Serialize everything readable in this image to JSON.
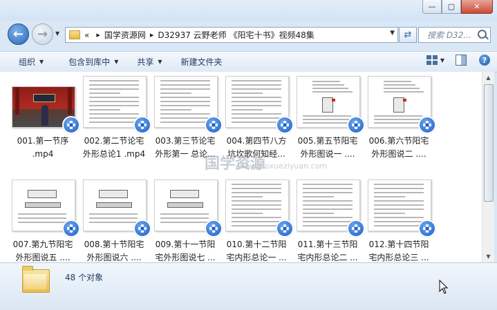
{
  "window": {
    "controls": {
      "minimize": "—",
      "maximize": "▢",
      "close": "✕"
    }
  },
  "nav": {
    "back": "←",
    "forward": "→"
  },
  "address": {
    "prefix": "«",
    "segments": [
      "国学资源网",
      "D32937  云野老师 《阳宅十书》视频48集"
    ],
    "separator": "▸"
  },
  "search": {
    "placeholder": "搜索 D32..."
  },
  "toolbar": {
    "organize": "组织",
    "include_in_library": "包含到库中",
    "share": "共享",
    "new_folder": "新建文件夹",
    "help": "?"
  },
  "watermark": {
    "text": "国学资源",
    "url": "www.guoxueziyuan.com"
  },
  "files": [
    {
      "line1": "001.第一节序",
      "line2": ".mp4"
    },
    {
      "line1": "002.第二节论宅",
      "line2": "外形总论1 .mp4"
    },
    {
      "line1": "003.第三节论宅",
      "line2": "外形第一 总论..."
    },
    {
      "line1": "004.第四节八方",
      "line2": "坑坎歌何知经..."
    },
    {
      "line1": "005.第五节阳宅",
      "line2": "外形图说一 ...."
    },
    {
      "line1": "006.第六节阳宅",
      "line2": "外形图说二 ...."
    },
    {
      "line1": "007.第九节阳宅",
      "line2": "外形图说五 ...."
    },
    {
      "line1": "008.第十节阳宅",
      "line2": "外形图说六 ...."
    },
    {
      "line1": "009.第十一节阳",
      "line2": "宅外形图说七 ..."
    },
    {
      "line1": "010.第十二节阳",
      "line2": "宅内形总论一 ..."
    },
    {
      "line1": "011.第十三节阳",
      "line2": "宅内形总论二 ..."
    },
    {
      "line1": "012.第十四节阳",
      "line2": "宅内形总论三 ..."
    }
  ],
  "status": {
    "count": "48 个对象"
  },
  "colors": {
    "accent": "#1b5fc6",
    "toolbar_text": "#1e3a5f"
  }
}
